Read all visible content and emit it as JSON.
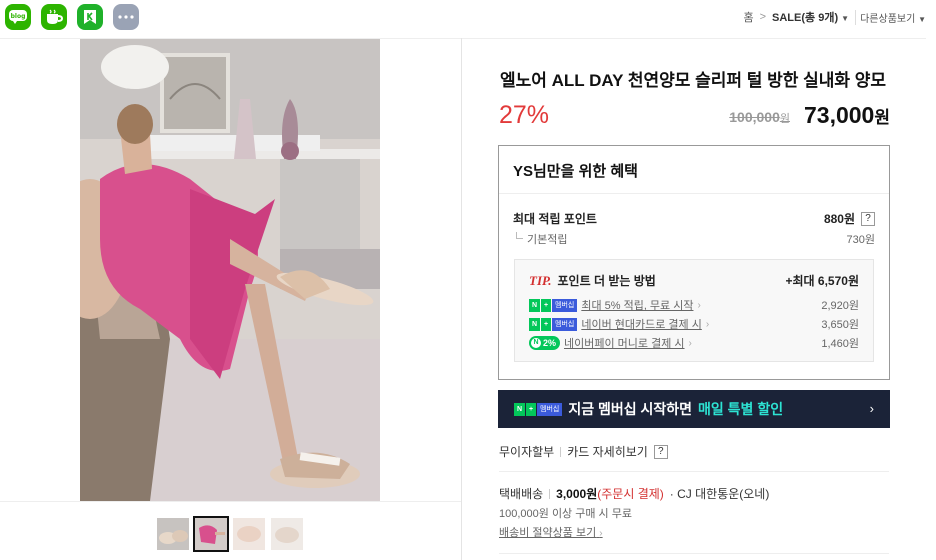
{
  "share": {
    "items": [
      {
        "name": "blog",
        "label": "blog"
      },
      {
        "name": "cafe",
        "label": "cafe"
      },
      {
        "name": "post",
        "label": "post"
      },
      {
        "name": "more",
        "label": "..."
      }
    ]
  },
  "breadcrumb": {
    "home": "홈",
    "separator": ">",
    "category": "SALE(총 9개)",
    "other_products": "다른상품보기"
  },
  "product": {
    "title": "엘노어 ALL DAY 천연양모 슬리퍼 털 방한 실내화 양모",
    "discount": "27%",
    "original_price": "100,000",
    "original_unit": "원",
    "price": "73,000",
    "price_unit": "원"
  },
  "benefit": {
    "heading": "YS님만을 위한 혜택",
    "max_points_label": "최대 적립 포인트",
    "max_points_value": "880원",
    "help_label": "?",
    "base_label": "기본적립",
    "base_value": "730원",
    "tip_label": "TIP.",
    "tip_heading": "포인트 더 받는 방법",
    "tip_max": "+최대 6,570원",
    "tips": [
      {
        "badge": "멤버십",
        "text": "최대 5% 적립, 무료 시작",
        "value": "2,920원"
      },
      {
        "badge": "멤버십",
        "text": "네이버 현대카드로 결제 시",
        "value": "3,650원"
      },
      {
        "badge": "2%",
        "text": "네이버페이 머니로 결제 시",
        "value": "1,460원"
      }
    ]
  },
  "membership_banner": {
    "badge": "멤버십",
    "text": "지금 멤버십 시작하면",
    "highlight": "매일 특별 할인",
    "arrow": "›"
  },
  "payment": {
    "installment": "무이자할부",
    "card_details": "카드 자세히보기",
    "help": "?"
  },
  "shipping": {
    "method": "택배배송",
    "fee": "3,000원",
    "fee_note": "(주문시 결제)",
    "carrier": "· CJ 대한통운(오네)",
    "free_condition": "100,000원 이상 구매 시 무료",
    "saving_link": "배송비 절약상품 보기"
  },
  "gallery": {
    "thumb_count": 4,
    "active_index": 1
  }
}
